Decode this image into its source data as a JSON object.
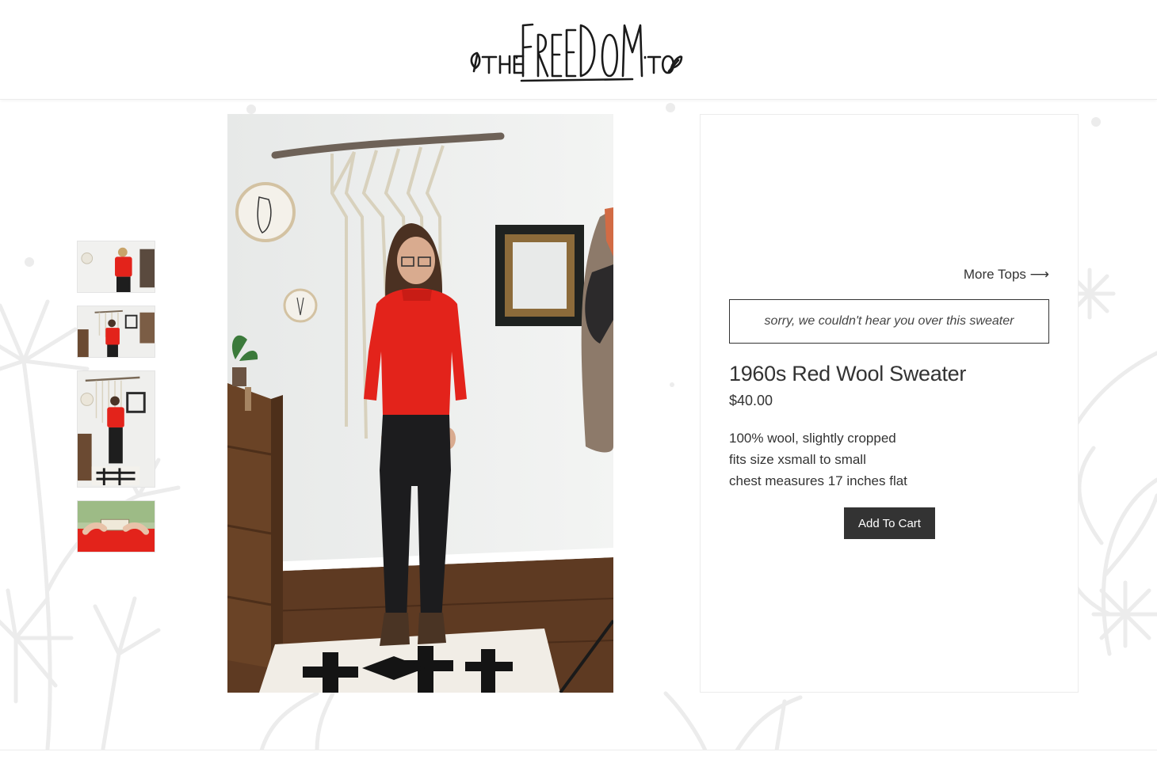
{
  "header": {
    "logo_text": "THE FREEDOM TO"
  },
  "gallery": {
    "thumbnails": [
      {
        "name": "thumb-front-closeup"
      },
      {
        "name": "thumb-front-wide"
      },
      {
        "name": "thumb-full-length"
      },
      {
        "name": "thumb-label-detail"
      }
    ]
  },
  "product": {
    "more_link": "More Tops ⟶",
    "tagline": "sorry, we couldn't hear you over this sweater",
    "title": "1960s Red Wool Sweater",
    "price": "$40.00",
    "description": [
      "100% wool, slightly cropped",
      "fits size xsmall to small",
      "chest measures 17 inches flat"
    ],
    "add_to_cart": "Add To Cart"
  },
  "colors": {
    "sweater_red": "#e3231b",
    "button_bg": "#333333",
    "text": "#333333"
  }
}
